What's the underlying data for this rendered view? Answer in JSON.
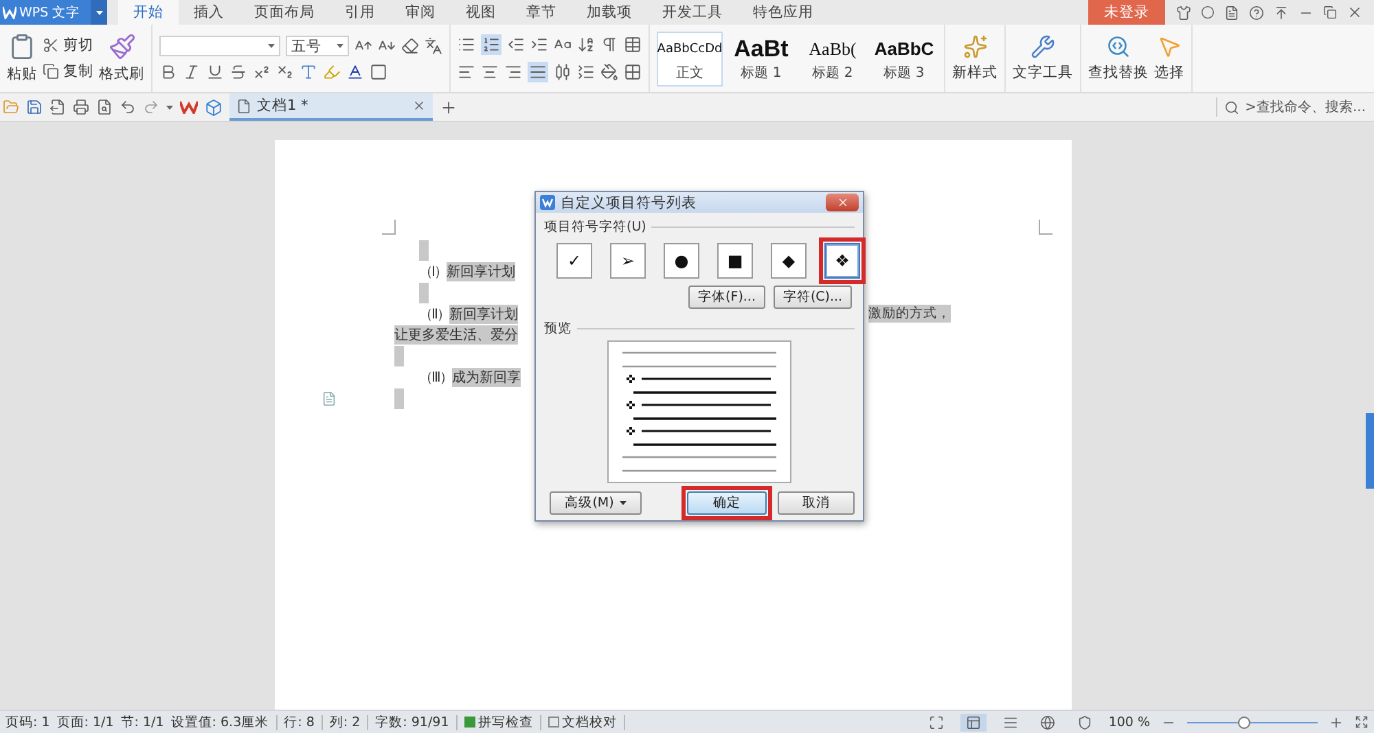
{
  "app": {
    "logo": "WPS 文字"
  },
  "tabs": [
    {
      "label": "开始",
      "selected": true
    },
    {
      "label": "插入",
      "selected": false
    },
    {
      "label": "页面布局",
      "selected": false
    },
    {
      "label": "引用",
      "selected": false
    },
    {
      "label": "审阅",
      "selected": false
    },
    {
      "label": "视图",
      "selected": false
    },
    {
      "label": "章节",
      "selected": false
    },
    {
      "label": "加载项",
      "selected": false
    },
    {
      "label": "开发工具",
      "selected": false
    },
    {
      "label": "特色应用",
      "selected": false
    }
  ],
  "login": "未登录",
  "ribbon": {
    "clipboard": {
      "paste": "粘贴",
      "cut": "剪切",
      "copy": "复制",
      "format_painter": "格式刷"
    },
    "font": {
      "size": "五号"
    },
    "paragraph": {
      "numbering": {
        "on": true
      },
      "justify": {
        "on": true
      }
    },
    "styles": [
      {
        "preview": "AaBbCcDd",
        "label": "正文",
        "kind": "body",
        "selected": true
      },
      {
        "preview": "AaBt",
        "label": "标题 1",
        "kind": "h1",
        "selected": false
      },
      {
        "preview": "AaBb(",
        "label": "标题 2",
        "kind": "h2",
        "selected": false
      },
      {
        "preview": "AaBbC",
        "label": "标题 3",
        "kind": "h3",
        "selected": false
      }
    ],
    "new_style": "新样式",
    "text_tools": "文字工具",
    "find_replace": "查找替换",
    "select": "选择"
  },
  "quick_bar": {
    "document_tab": "文档1 *",
    "search": {
      "placeholder": ">查找命令、搜索..."
    }
  },
  "document": {
    "lines": [
      {
        "kind": "empty",
        "indent": true
      },
      {
        "kind": "text",
        "indent": true,
        "number": "（I）",
        "text": "新回享计划"
      },
      {
        "kind": "empty",
        "indent": true
      },
      {
        "kind": "text",
        "indent": true,
        "number": "（II）",
        "text": "新回享计划",
        "tail": "激励的方式，"
      },
      {
        "kind": "text",
        "indent": false,
        "text": "让更多爱生活、爱分"
      },
      {
        "kind": "empty",
        "indent": false
      },
      {
        "kind": "text",
        "indent": true,
        "number": "（III）",
        "text": "成为新回享"
      },
      {
        "kind": "empty",
        "indent": false
      }
    ]
  },
  "dialog": {
    "title": "自定义项目符号列表",
    "symbols_label": "项目符号字符(U)",
    "symbols": [
      {
        "char": "✓",
        "selected": false,
        "highlighted": false
      },
      {
        "char": "➢",
        "selected": false,
        "highlighted": false
      },
      {
        "char": "●",
        "selected": false,
        "highlighted": false
      },
      {
        "char": "■",
        "selected": false,
        "highlighted": false
      },
      {
        "char": "◆",
        "selected": false,
        "highlighted": false
      },
      {
        "char": "❖",
        "selected": true,
        "highlighted": true
      }
    ],
    "font_button": "字体(F)...",
    "char_button": "字符(C)...",
    "preview_label": "预览",
    "advanced": "高级(M)",
    "ok": {
      "label": "确定",
      "highlighted": true
    },
    "cancel": "取消"
  },
  "status_bar": {
    "fields": [
      "页码: 1",
      "页面: 1/1",
      "节: 1/1",
      "设置值: 6.3厘米",
      "行: 8",
      "列: 2",
      "字数: 91/91"
    ],
    "checks": [
      {
        "label": "拼写检查",
        "checked": true
      },
      {
        "label": "文档校对",
        "checked": false
      }
    ],
    "views": [
      {
        "kind": "fullscreen",
        "selected": false
      },
      {
        "kind": "page",
        "selected": true
      },
      {
        "kind": "outline",
        "selected": false
      },
      {
        "kind": "web",
        "selected": false
      },
      {
        "kind": "protect",
        "selected": false
      }
    ],
    "zoom": "100 %",
    "zoom_slider": {
      "level": 0.43
    }
  }
}
